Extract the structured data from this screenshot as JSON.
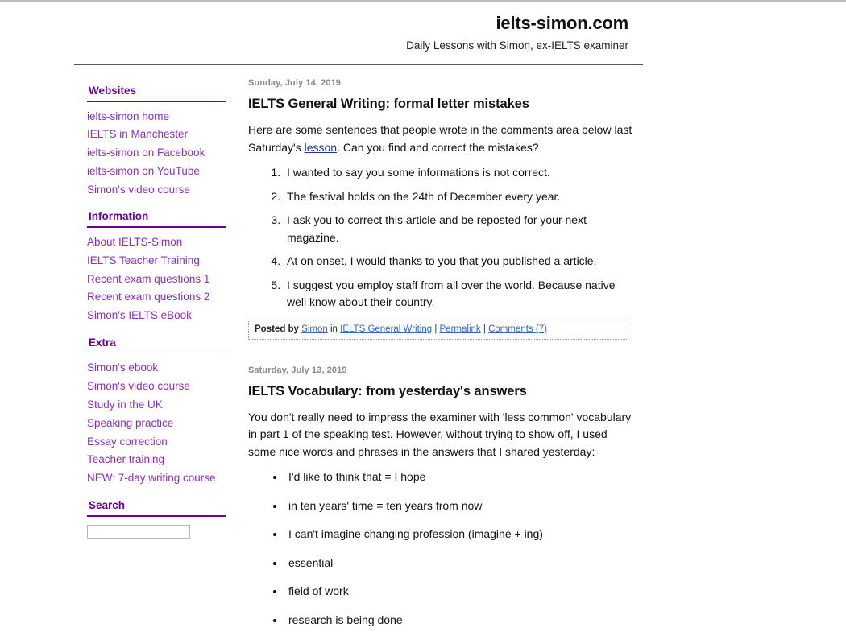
{
  "site": {
    "title": "ielts-simon.com",
    "tagline": "Daily Lessons with Simon, ex-IELTS examiner"
  },
  "colors": {
    "sidebar_link": "#8b2ec0",
    "sidebar_heading": "#6b0099",
    "body_link": "#1a3a8f",
    "footer_link": "#3366cc",
    "date_text": "#8a8a8a"
  },
  "sidebar": {
    "sections": [
      {
        "heading": "Websites",
        "links": [
          "ielts-simon home",
          "IELTS in Manchester",
          "ielts-simon on Facebook",
          "ielts-simon on YouTube",
          "Simon's video course"
        ]
      },
      {
        "heading": "Information",
        "links": [
          "About IELTS-Simon",
          "IELTS Teacher Training",
          "Recent exam questions 1",
          "Recent exam questions 2",
          "Simon's IELTS eBook"
        ]
      },
      {
        "heading": "Extra",
        "links": [
          "Simon's ebook",
          "Simon's video course",
          "Study in the UK",
          "Speaking practice",
          "Essay correction",
          "Teacher training",
          "NEW: 7-day writing course"
        ]
      },
      {
        "heading": "Search",
        "links": []
      }
    ],
    "search": {
      "value": "",
      "placeholder": ""
    }
  },
  "posts": [
    {
      "date": "Sunday, July 14, 2019",
      "title": "IELTS General Writing: formal letter mistakes",
      "para_before_link": "Here are some sentences that people wrote in the comments area below last Saturday's ",
      "link_text": "lesson",
      "para_after_link": ". Can you find and correct the mistakes?",
      "list_type": "ordered",
      "list_items": [
        "I wanted to say you some informations is not correct.",
        "The festival holds on the 24th of December every year.",
        "I ask you to correct this article and be reposted for your next magazine.",
        "At on onset, I would thanks to you that you published a article.",
        "I suggest you employ staff from all over the world. Because native well know about their country."
      ],
      "footer": {
        "posted_by_label": "Posted by",
        "author": "Simon",
        "in_label": "in",
        "category": "IELTS General Writing",
        "permalink": "Permalink",
        "comments": "Comments (7)"
      }
    },
    {
      "date": "Saturday, July 13, 2019",
      "title": "IELTS Vocabulary: from yesterday's answers",
      "para": "You don't really need to impress the examiner with 'less common' vocabulary in part 1 of the speaking test. However, without trying to show off, I used some nice words and phrases in the answers that I shared yesterday:",
      "list_type": "unordered",
      "list_items": [
        "I'd like to think that = I hope",
        "in ten years' time = ten years from now",
        "I can't imagine changing profession (imagine + ing)",
        "essential",
        "field of work",
        "research is being done"
      ]
    }
  ]
}
